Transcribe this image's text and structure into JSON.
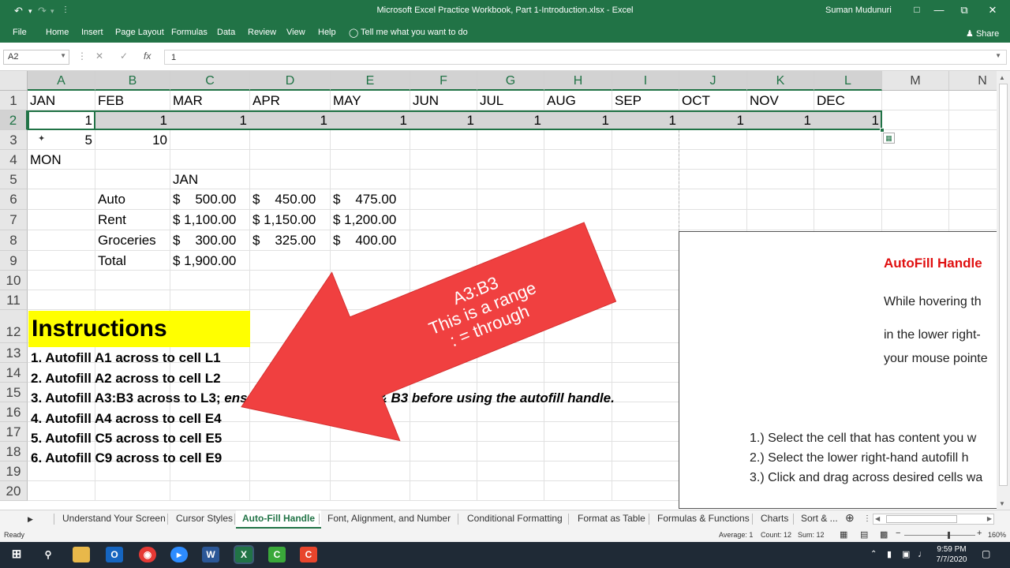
{
  "window": {
    "title": "Microsoft Excel Practice Workbook, Part 1-Introduction.xlsx  -  Excel",
    "user": "Suman Mudunuri",
    "undo_icon": "undo-icon",
    "redo_icon": "redo-icon",
    "minimize": "—",
    "restore": "⧉",
    "close": "✕"
  },
  "ribbon": {
    "tabs": [
      "File",
      "Home",
      "Insert",
      "Page Layout",
      "Formulas",
      "Data",
      "Review",
      "View",
      "Help"
    ],
    "tell_me": "Tell me what you want to do",
    "share": "Share"
  },
  "formula_bar": {
    "name_box": "A2",
    "value": "1",
    "cancel_icon": "✕",
    "enter_icon": "✓",
    "fx_icon": "fx"
  },
  "grid": {
    "columns": [
      "A",
      "B",
      "C",
      "D",
      "E",
      "F",
      "G",
      "H",
      "I",
      "J",
      "K",
      "L",
      "M",
      "N"
    ],
    "rows": [
      "1",
      "2",
      "3",
      "4",
      "5",
      "6",
      "7",
      "8",
      "9",
      "10",
      "11",
      "12",
      "13",
      "14",
      "15",
      "16",
      "17",
      "18",
      "19",
      "20"
    ],
    "row1": [
      "JAN",
      "FEB",
      "MAR",
      "APR",
      "MAY",
      "JUN",
      "JUL",
      "AUG",
      "SEP",
      "OCT",
      "NOV",
      "DEC"
    ],
    "row2": [
      "1",
      "1",
      "1",
      "1",
      "1",
      "1",
      "1",
      "1",
      "1",
      "1",
      "1",
      "1"
    ],
    "row3": [
      "5",
      "10"
    ],
    "a4": "MON",
    "c5": "JAN",
    "budget": [
      {
        "label": "Auto",
        "c": "$    500.00",
        "d": "$    450.00",
        "e": "$    475.00"
      },
      {
        "label": "Rent",
        "c": "$ 1,100.00",
        "d": "$ 1,150.00",
        "e": "$ 1,200.00"
      },
      {
        "label": "Groceries",
        "c": "$    300.00",
        "d": "$    325.00",
        "e": "$    400.00"
      },
      {
        "label": "Total",
        "c": "$ 1,900.00",
        "d": "",
        "e": ""
      }
    ]
  },
  "instructions": {
    "title": "Instructions",
    "items": [
      "1. Autofill A1 across to cell L1",
      "2. Autofill A2 across to cell L2",
      "3. Autofill A3:B3 across to L3; ",
      "4. Autofill A4 across to cell E4",
      "5. Autofill C5 across to cell E5",
      "6. Autofill C9 across to cell E9"
    ],
    "item3_italic_a": "ensure to se",
    "item3_italic_b": "A3 & B3 before using the autofill handle."
  },
  "callout": {
    "line1": "A3:B3",
    "line2": "This is a range",
    "line3": ": = through",
    "color": "#f04040"
  },
  "textbox": {
    "title": "AutoFill Handle",
    "lines": [
      "While hovering th",
      "in the lower right-",
      "your mouse pointe",
      "1.) Select the cell that has content you w",
      "2.) Select the lower right-hand autofill h",
      "3.) Click and drag across desired cells wa"
    ]
  },
  "sheets": {
    "tabs": [
      "Understand Your Screen",
      "Cursor Styles",
      "Auto-Fill Handle",
      "Font, Alignment, and Number",
      "Conditional Formatting",
      "Format as Table",
      "Formulas & Functions",
      "Charts",
      "Sort & ..."
    ],
    "active": "Auto-Fill Handle"
  },
  "status": {
    "ready": "Ready",
    "average": "Average: 1",
    "count": "Count: 12",
    "sum": "Sum: 12",
    "zoom": "160%"
  },
  "taskbar": {
    "time": "9:59 PM",
    "date": "7/7/2020"
  },
  "colors": {
    "excel_green": "#217346",
    "highlight": "#ffff00",
    "callout_red": "#f04040"
  }
}
